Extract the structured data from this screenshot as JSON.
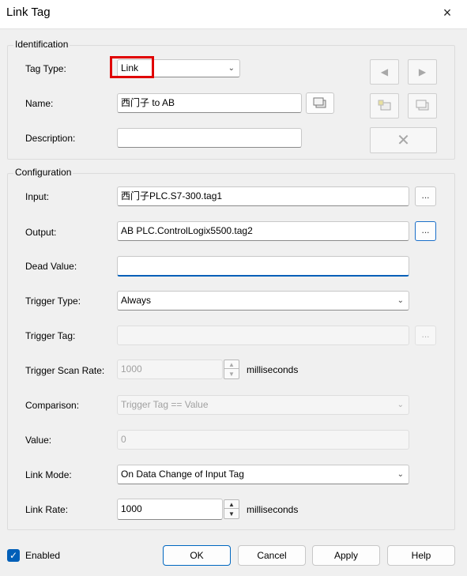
{
  "window": {
    "title": "Link Tag",
    "close_icon": "×"
  },
  "identification": {
    "group_title": "Identification",
    "tag_type": {
      "label": "Tag Type:",
      "value": "Link"
    },
    "name": {
      "label": "Name:",
      "value": "西门子 to AB"
    },
    "description": {
      "label": "Description:",
      "value": ""
    }
  },
  "configuration": {
    "group_title": "Configuration",
    "input": {
      "label": "Input:",
      "value": "西门子PLC.S7-300.tag1",
      "browse": "..."
    },
    "output": {
      "label": "Output:",
      "value": "AB PLC.ControlLogix5500.tag2",
      "browse": "..."
    },
    "dead_value": {
      "label": "Dead Value:",
      "value": ""
    },
    "trigger_type": {
      "label": "Trigger Type:",
      "value": "Always"
    },
    "trigger_tag": {
      "label": "Trigger Tag:",
      "value": "",
      "browse": "..."
    },
    "trigger_scan_rate": {
      "label": "Trigger Scan Rate:",
      "value": "1000",
      "unit": "milliseconds"
    },
    "comparison": {
      "label": "Comparison:",
      "value": "Trigger Tag == Value"
    },
    "value": {
      "label": "Value:",
      "value": "0"
    },
    "link_mode": {
      "label": "Link Mode:",
      "value": "On Data Change of Input Tag"
    },
    "link_rate": {
      "label": "Link Rate:",
      "value": "1000",
      "unit": "milliseconds"
    }
  },
  "footer": {
    "enabled_label": "Enabled",
    "enabled_checked": true,
    "ok": "OK",
    "cancel": "Cancel",
    "apply": "Apply",
    "help": "Help"
  },
  "colors": {
    "accent": "#005fb8",
    "highlight": "#e00000",
    "dialog_bg": "#f0f0f0"
  }
}
